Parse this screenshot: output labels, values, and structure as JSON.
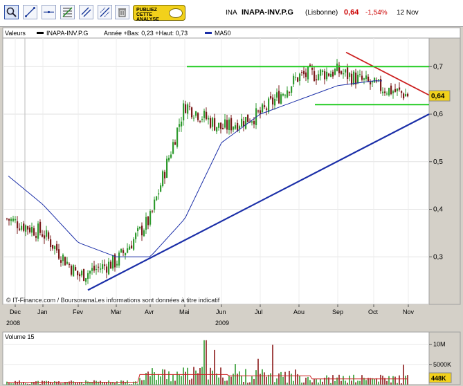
{
  "toolbar": {
    "buttons": [
      {
        "name": "zoom-tool-button",
        "icon": "zoom-icon"
      },
      {
        "name": "trendline-tool-button",
        "icon": "trendline-icon"
      },
      {
        "name": "horizontal-line-tool-button",
        "icon": "horizontal-line-icon"
      },
      {
        "name": "fibonacci-tool-button",
        "icon": "fibonacci-icon"
      },
      {
        "name": "channel-tool-button",
        "icon": "channel-icon"
      },
      {
        "name": "parallel-lines-tool-button",
        "icon": "parallel-lines-icon"
      },
      {
        "name": "delete-drawings-button",
        "icon": "trash-icon"
      }
    ],
    "ad_line1": "PUBLIEZ",
    "ad_line2": "CETTE",
    "ad_line3": "ANALYSE"
  },
  "quote": {
    "ticker": "INA",
    "name": "INAPA-INV.P.G",
    "exchange": "(Lisbonne)",
    "price": "0,64",
    "change": "-1,54%",
    "date": "12 Nov",
    "colors": {
      "change": "#cc0000",
      "price": "#cc0000"
    }
  },
  "chart_data": [
    {
      "type": "candlestick",
      "header": {
        "valeurs": "Valeurs",
        "series_label": "INAPA-INV.P.G",
        "range_text": "Année +Bas: 0,23 +Haut: 0,73",
        "ma_label": "MA50"
      },
      "y_ticks": [
        "0,3",
        "0,4",
        "0,5",
        "0,6",
        "0,7"
      ],
      "y_tick_values": [
        0.3,
        0.4,
        0.5,
        0.6,
        0.7
      ],
      "ylim": [
        0.2,
        0.76
      ],
      "last_value_label": "0,64",
      "x_months": [
        "Dec",
        "Jan",
        "Fev",
        "Mar",
        "Avr",
        "Mai",
        "Jun",
        "Jul",
        "Aou",
        "Sep",
        "Oct",
        "Nov"
      ],
      "x_years": [
        "2008",
        "2009"
      ],
      "credit": "© IT-Finance.com / BoursoramaLes informations sont données à titre indicatif",
      "price_by_month": {
        "Dec": 0.38,
        "Jan": 0.35,
        "Fev": 0.26,
        "Mar": 0.29,
        "Avr": 0.38,
        "Mai": 0.62,
        "Jun": 0.57,
        "Jul": 0.6,
        "Aou": 0.68,
        "Sep": 0.69,
        "Oct": 0.66,
        "Nov": 0.64
      },
      "ma50_by_month": {
        "Dec": 0.47,
        "Jan": 0.41,
        "Fev": 0.33,
        "Mar": 0.3,
        "Avr": 0.3,
        "Mai": 0.38,
        "Jun": 0.54,
        "Jul": 0.6,
        "Aou": 0.63,
        "Sep": 0.66,
        "Oct": 0.67
      },
      "support_line": {
        "from": [
          "Fev",
          0.23
        ],
        "to": [
          "Nov",
          0.6
        ],
        "color": "#1b2fa8"
      },
      "resistance_line": {
        "from": [
          "Sep",
          0.73
        ],
        "to": [
          "Nov",
          0.64
        ],
        "color": "#cc1f1f"
      },
      "horizontal_lines": [
        0.7,
        0.62
      ],
      "horizontal_color": "#22cc22",
      "colors": {
        "up": "#2e9a2e",
        "down": "#7a1a1a",
        "ma": "#1b2fa8"
      }
    },
    {
      "type": "bar",
      "title": "Volume 15",
      "y_ticks": [
        "5000K",
        "10M"
      ],
      "y_tick_values": [
        5000,
        10000
      ],
      "last_value_label": "448K",
      "ylim": [
        0,
        12000
      ],
      "colors": {
        "up": "#2e9a2e",
        "down": "#8b1a1a",
        "ma": "#cc2222"
      }
    }
  ]
}
